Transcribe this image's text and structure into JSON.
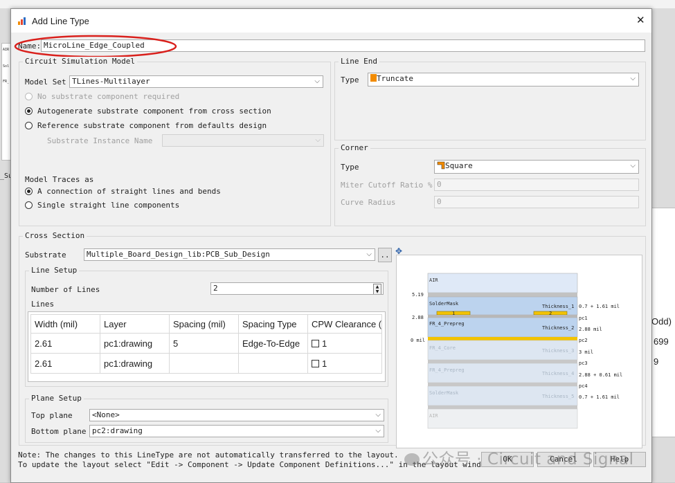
{
  "background_app": {
    "left_labels": [
      "AIR",
      "Sol",
      "FR_"
    ],
    "left_tab": "_Su",
    "right_header": "Odd)",
    "right_values": [
      "699",
      "9"
    ]
  },
  "dialog": {
    "title": "Add Line Type",
    "close_glyph": "✕",
    "name_label": "Name:",
    "name_value": "MicroLine_Edge_Coupled"
  },
  "circuit_model": {
    "title": "Circuit Simulation Model",
    "model_set_label": "Model Set",
    "model_set_value": "TLines-Multilayer",
    "radio_no_substrate": "No substrate component required",
    "radio_autogenerate": "Autogenerate substrate component from cross section",
    "radio_reference": "Reference substrate component from defaults design",
    "substrate_instance_label": "Substrate Instance Name",
    "substrate_instance_value": "",
    "model_traces_label": "Model Traces as",
    "radio_connection": "A connection of straight lines and bends",
    "radio_single": "Single straight line components"
  },
  "line_end": {
    "title": "Line End",
    "type_label": "Type",
    "type_value": "Truncate"
  },
  "corner": {
    "title": "Corner",
    "type_label": "Type",
    "type_value": "Square",
    "miter_label": "Miter Cutoff Ratio %",
    "miter_value": "0",
    "curve_label": "Curve Radius",
    "curve_value": "0"
  },
  "cross_section": {
    "title": "Cross Section",
    "substrate_label": "Substrate",
    "substrate_value": "Multiple_Board_Design_lib:PCB_Sub_Design",
    "browse_label": "..",
    "line_setup_title": "Line Setup",
    "num_lines_label": "Number of Lines",
    "num_lines_value": "2",
    "lines_label": "Lines",
    "columns": [
      "Width (mil)",
      "Layer",
      "Spacing (mil)",
      "Spacing Type",
      "CPW Clearance (m"
    ],
    "rows": [
      {
        "width": "2.61",
        "layer": "pc1:drawing",
        "spacing": "5",
        "spacing_type": "Edge-To-Edge",
        "cpw": "1"
      },
      {
        "width": "2.61",
        "layer": "pc1:drawing",
        "spacing": "",
        "spacing_type": "",
        "cpw": "1"
      }
    ],
    "plane_setup_title": "Plane Setup",
    "top_plane_label": "Top plane",
    "top_plane_value": "<None>",
    "bottom_plane_label": "Bottom plane",
    "bottom_plane_value": "pc2:drawing"
  },
  "stackup": {
    "layers": [
      {
        "name": "AIR",
        "right": "",
        "dim": false
      },
      {
        "name": "SolderMask",
        "right": "Thickness_1",
        "dim": false
      },
      {
        "name": "FR_4_Prepreg",
        "right": "Thickness_2",
        "dim": false
      },
      {
        "name": "FR_4_Core",
        "right": "Thickness_3",
        "dim": true
      },
      {
        "name": "FR_4_Prepreg",
        "right": "Thickness_4",
        "dim": true
      },
      {
        "name": "SolderMask",
        "right": "Thickness_5",
        "dim": true
      },
      {
        "name": "AIR",
        "right": "",
        "dim": true
      }
    ],
    "left_values": [
      "5.19",
      "2.88",
      "0 mil"
    ],
    "right_labels": [
      "0.7 + 1.61 mil",
      "pc1",
      "2.88 mil",
      "pc2",
      "3 mil",
      "pc3",
      "2.88 + 0.61 mil",
      "pc4",
      "0.7 + 1.61 mil"
    ],
    "trace_labels": [
      "1",
      "2"
    ],
    "colors": {
      "air": "#dfe9f7",
      "mask": "#bcd3ee",
      "metal": "#f2c300",
      "plane": "#b8b8b8"
    }
  },
  "footer": {
    "note_line1": "Note: The changes to this LineType are not automatically transferred to the layout.",
    "note_line2": "To update the layout select \"Edit -> Component -> Update Component Definitions...\" in the layout window.",
    "ok_label": "OK",
    "cancel_label": "Cancel",
    "help_label": "Help"
  },
  "watermark": "公众号 · Circuit and Signal"
}
